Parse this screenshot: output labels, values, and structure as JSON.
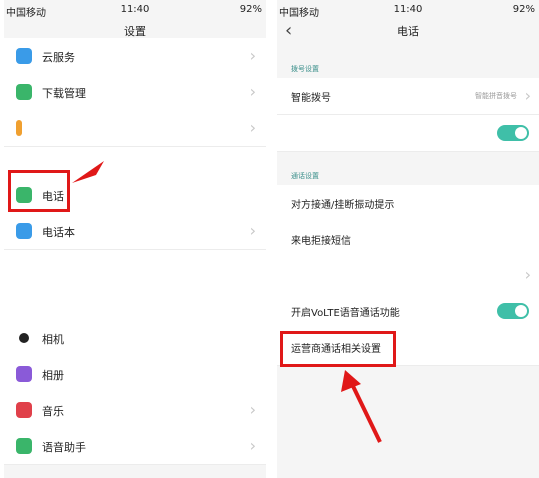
{
  "left": {
    "status": {
      "carrier": "中国移动",
      "time": "11:40",
      "battery": "92%"
    },
    "title": "设置",
    "items": [
      {
        "label": "云服务",
        "icon": "cloud-icon",
        "color": "#3a9be8"
      },
      {
        "label": "下载管理",
        "icon": "download-icon",
        "color": "#3ab56a"
      },
      {
        "label": "",
        "icon": "app-icon",
        "color": "#f0a030"
      },
      {
        "label": "电话",
        "icon": "phone-icon",
        "color": "#3ab56a"
      },
      {
        "label": "电话本",
        "icon": "contacts-icon",
        "color": "#3a9be8"
      },
      {
        "label": "相机",
        "icon": "camera-icon",
        "color": "#222222"
      },
      {
        "label": "相册",
        "icon": "gallery-icon",
        "color": "#8a5ad8"
      },
      {
        "label": "音乐",
        "icon": "music-icon",
        "color": "#e0404a"
      },
      {
        "label": "语音助手",
        "icon": "voice-assistant-icon",
        "color": "#3ab56a"
      }
    ]
  },
  "right": {
    "status": {
      "carrier": "中国移动",
      "time": "11:40",
      "battery": "92%"
    },
    "title": "电话",
    "section_dial": "拨号设置",
    "smart_dial": {
      "label": "智能拨号",
      "value": "智能拼音拨号"
    },
    "section_call": "通话设置",
    "items": [
      {
        "label": "对方接通/挂断振动提示"
      },
      {
        "label": "来电拒接短信"
      }
    ],
    "volte": {
      "label": "开启VoLTE语音通话功能",
      "on": true
    },
    "carrier_settings": {
      "label": "运营商通话相关设置"
    },
    "colors": {
      "accent": "#3fbfa8",
      "highlight": "#e01818"
    }
  }
}
